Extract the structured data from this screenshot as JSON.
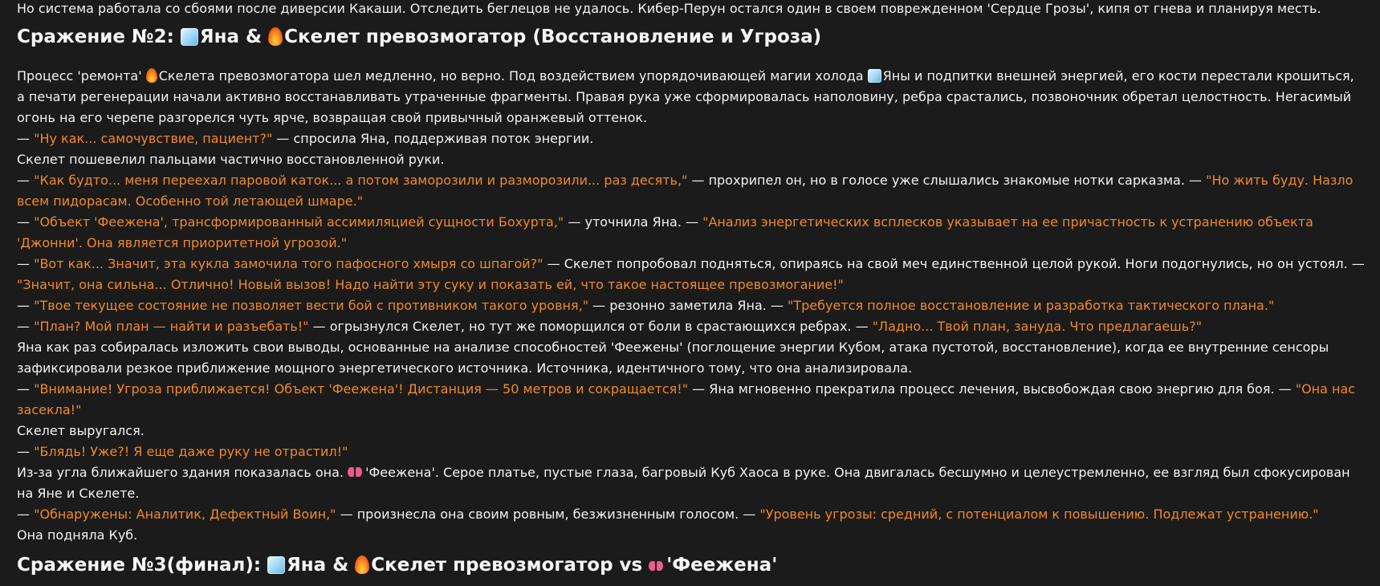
{
  "top_line": "Но система работала со сбоями после диверсии Какаши. Отследить беглецов не удалось. Кибер-Перун остался один в своем поврежденном 'Сердце Грозы', кипя от гнева и планируя месть.",
  "battle2": {
    "title_prefix": "Сражение №2: ",
    "name1": "Яна & ",
    "name2": "Скелет превозмогатор (Восстановление и Угроза)",
    "icons": [
      "ice-cube",
      "fire"
    ]
  },
  "p1": {
    "a": "Процесс 'ремонта' ",
    "b": "Скелета превозмогатора шел медленно, но верно. Под воздействием упорядочивающей магии холода ",
    "c": "Яны и подпитки внешней энергией, его кости перестали крошиться, а печати регенерации начали активно восстанавливать утраченные фрагменты. Правая рука уже сформировалась наполовину, ребра срастались, позвоночник обретал целостность. Негасимый огонь на его черепе разгорелся чуть ярче, возвращая свой привычный оранжевый оттенок."
  },
  "d1": {
    "dash": "— ",
    "q": "\"Ну как... самочувствие, пациент?\"",
    "t": " — спросила Яна, поддерживая поток энергии."
  },
  "s1": "Скелет пошевелил пальцами частично восстановленной руки.",
  "d2": {
    "dash": "— ",
    "q1": "\"Как будто... меня переехал паровой каток... а потом заморозили и разморозили... раз десять,\"",
    "t": " — прохрипел он, но в голосе уже слышались знакомые нотки сарказма. — ",
    "q2": "\"Но жить буду. Назло всем пидорасам. Особенно той летающей шмаре.\""
  },
  "d3": {
    "dash": "— ",
    "q1": "\"Объект 'Феежена', трансформированный ассимиляцией сущности Бохурта,\"",
    "t": " — уточнила Яна. — ",
    "q2": "\"Анализ энергетических всплесков указывает на ее причастность к устранению объекта 'Джонни'. Она является приоритетной угрозой.\""
  },
  "d4": {
    "dash": "— ",
    "q1": "\"Вот как... Значит, эта кукла замочила того пафосного хмыря со шпагой?\"",
    "t": " — Скелет попробовал подняться, опираясь на свой меч единственной целой рукой. Ноги подогнулись, но он устоял. — ",
    "q2": "\"Значит, она сильна... Отлично! Новый вызов! Надо найти эту суку и показать ей, что такое настоящее превозмогание!\""
  },
  "d5": {
    "dash": "— ",
    "q1": "\"Твое текущее состояние не позволяет вести бой с противником такого уровня,\"",
    "t": " — резонно заметила Яна. — ",
    "q2": "\"Требуется полное восстановление и разработка тактического плана.\""
  },
  "d6": {
    "dash": "— ",
    "q1": "\"План? Мой план — найти и разъебать!\"",
    "t": " — огрызнулся Скелет, но тут же поморщился от боли в срастающихся ребрах. — ",
    "q2": "\"Ладно... Твой план, зануда. Что предлагаешь?\""
  },
  "p2": "Яна как раз собиралась изложить свои выводы, основанные на анализе способностей 'Феежены' (поглощение энергии Кубом, атака пустотой, восстановление), когда ее внутренние сенсоры зафиксировали резкое приближение мощного энергетического источника. Источника, идентичного тому, что она анализировала.",
  "d7": {
    "dash": "— ",
    "q1": "\"Внимание! Угроза приближается! Объект 'Феежена'! Дистанция — 50 метров и сокращается!\"",
    "t": " — Яна мгновенно прекратила процесс лечения, высвобождая свою энергию для боя. — ",
    "q2": "\"Она нас засекла!\""
  },
  "s2": "Скелет выругался.",
  "d8": {
    "dash": "— ",
    "q": "\"Блядь! Уже?! Я еще даже руку не отрастил!\""
  },
  "p3": {
    "a": "Из-за угла ближайшего здания показалась она. ",
    "b": "'Феежена'. Серое платье, пустые глаза, багровый Куб Хаоса в руке. Она двигалась бесшумно и целеустремленно, ее взгляд был сфокусирован на Яне и Скелете."
  },
  "d9": {
    "dash": "— ",
    "q1": "\"Обнаружены: Аналитик, Дефектный Воин,\"",
    "t": " — произнесла она своим ровным, безжизненным голосом. — ",
    "q2": "\"Уровень угрозы: средний, с потенциалом к повышению. Подлежат устранению.\""
  },
  "s3": "Она подняла Куб.",
  "battle3_partial": {
    "a": "Сражение №3(финал): ",
    "b": "Яна & ",
    "c": "Скелет превозмогатор vs ",
    "d": "'Феежена'"
  },
  "colors": {
    "background": "#1b1b1b",
    "text": "#f2f2f2",
    "quote": "#f0892c"
  }
}
